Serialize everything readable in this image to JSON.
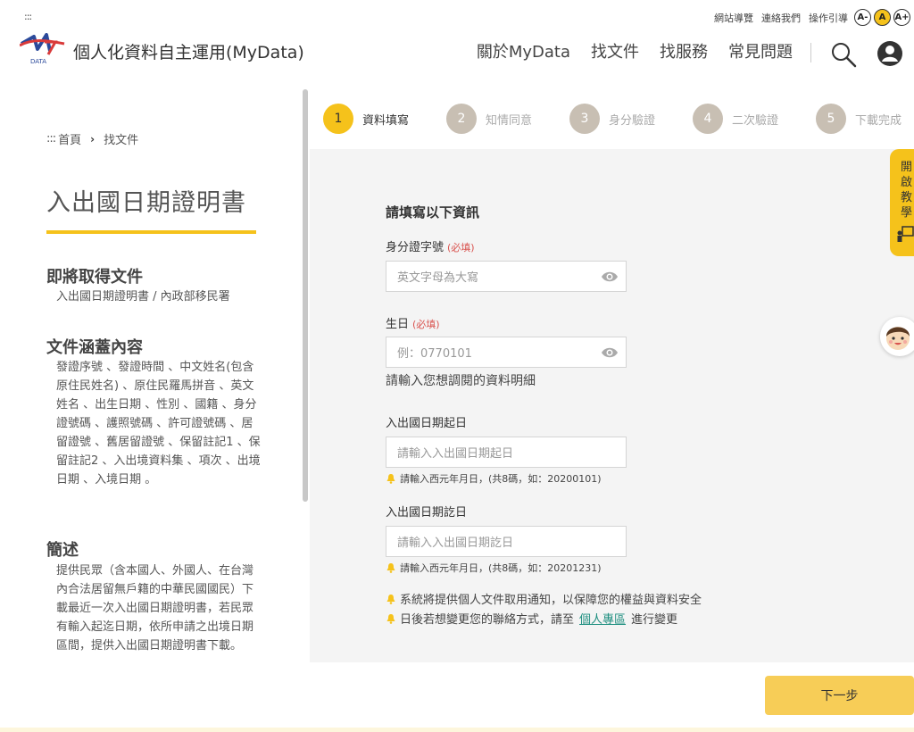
{
  "topbar": {
    "accesskey": ":::",
    "links": [
      "網站導覽",
      "連絡我們",
      "操作引導"
    ],
    "font_sizes": [
      "A-",
      "A",
      "A+"
    ],
    "font_active_index": 1
  },
  "header": {
    "logo_text": "DATA",
    "title": "個人化資料自主運用(MyData)",
    "nav": [
      "關於MyData",
      "找文件",
      "找服務",
      "常見問題"
    ]
  },
  "breadcrumb": {
    "prefix": ":::",
    "items": [
      "首頁",
      "找文件"
    ],
    "separator": "›"
  },
  "document": {
    "title": "入出國日期證明書",
    "obtain_heading": "即將取得文件",
    "obtain_text": "入出國日期證明書 / 內政部移民署",
    "coverage_heading": "文件涵蓋內容",
    "coverage_text": "發證序號 、發證時間 、中文姓名(包含原住民姓名) 、原住民羅馬拼音 、英文姓名 、出生日期 、性別 、國籍 、身分證號碼 、護照號碼 、許可證號碼 、居留證號 、舊居留證號 、保留註記1 、保留註記2 、入出境資料集 、項次 、出境日期 、入境日期 。",
    "summary_heading": "簡述",
    "summary_text": "提供民眾（含本國人、外國人、在台灣內合法居留無戶籍的中華民國國民）下載最近一次入出國日期證明書，若民眾有輸入起迄日期，依所申請之出境日期區間，提供入出國日期證明書下載。"
  },
  "steps": [
    {
      "num": "1",
      "label": "資料填寫",
      "active": true
    },
    {
      "num": "2",
      "label": "知情同意",
      "active": false
    },
    {
      "num": "3",
      "label": "身分驗證",
      "active": false
    },
    {
      "num": "4",
      "label": "二次驗證",
      "active": false
    },
    {
      "num": "5",
      "label": "下載完成",
      "active": false
    }
  ],
  "form": {
    "heading": "請填寫以下資訊",
    "required_tag": "(必填)",
    "id_label": "身分證字號",
    "id_placeholder": "英文字母為大寫",
    "birth_label": "生日",
    "birth_placeholder": "例：0770101",
    "detail_text": "請輸入您想調閱的資料明細",
    "start_label": "入出國日期起日",
    "start_placeholder": "請輸入入出國日期起日",
    "start_hint": "請輸入西元年月日，(共8碼，如：20200101)",
    "end_label": "入出國日期訖日",
    "end_placeholder": "請輸入入出國日期訖日",
    "end_hint": "請輸入西元年月日，(共8碼，如：20201231)",
    "note1": "系統將提供個人文件取用通知，以保障您的權益與資料安全",
    "note2_before": "日後若想變更您的聯絡方式，請至",
    "note2_link": "個人專區",
    "note2_after": "進行變更"
  },
  "tutorial": {
    "lines": [
      "開",
      "啟",
      "教",
      "學"
    ]
  },
  "actions": {
    "next": "下一步"
  },
  "colors": {
    "accent": "#f5c21b",
    "step_inactive": "#c8bfb3",
    "panel_bg": "#f4f4f4",
    "required": "#d9534f",
    "link": "#1f8f80"
  }
}
